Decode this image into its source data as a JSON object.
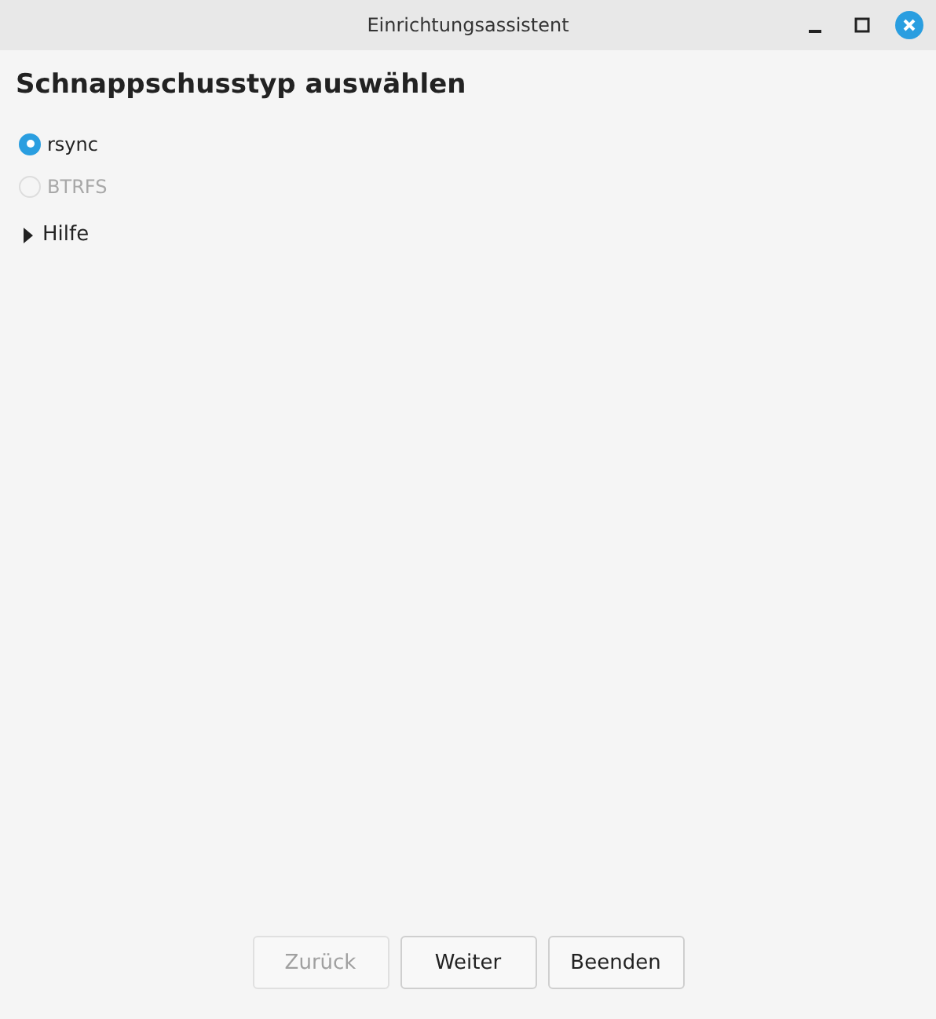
{
  "window": {
    "title": "Einrichtungsassistent"
  },
  "heading": "Schnappschusstyp auswählen",
  "options": [
    {
      "label": "rsync",
      "selected": true,
      "disabled": false
    },
    {
      "label": "BTRFS",
      "selected": false,
      "disabled": true
    }
  ],
  "expander": {
    "label": "Hilfe",
    "expanded": false
  },
  "buttons": [
    {
      "label": "Zurück",
      "disabled": true
    },
    {
      "label": "Weiter",
      "disabled": false
    },
    {
      "label": "Beenden",
      "disabled": false
    }
  ]
}
